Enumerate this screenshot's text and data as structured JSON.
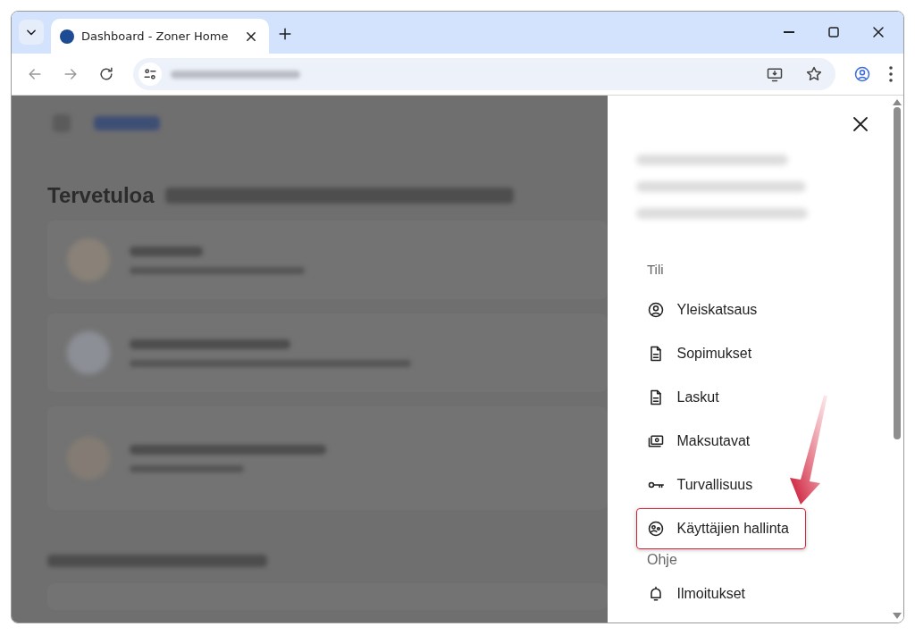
{
  "browser": {
    "tab": {
      "title": "Dashboard - Zoner Home",
      "selected": true
    }
  },
  "page": {
    "heading": "Tervetuloa"
  },
  "drawer": {
    "sections": [
      {
        "title": "Tili",
        "items": [
          {
            "label": "Yleiskatsaus",
            "kind": "person",
            "highlighted": false
          },
          {
            "label": "Sopimukset",
            "kind": "document",
            "highlighted": false
          },
          {
            "label": "Laskut",
            "kind": "document",
            "highlighted": false
          },
          {
            "label": "Maksutavat",
            "kind": "money",
            "highlighted": false
          },
          {
            "label": "Turvallisuus",
            "kind": "key",
            "highlighted": false
          },
          {
            "label": "Käyttäjien hallinta",
            "kind": "users",
            "highlighted": true
          }
        ]
      },
      {
        "title": "Ohje",
        "items": [
          {
            "label": "Ilmoitukset",
            "kind": "bell",
            "highlighted": false
          }
        ]
      }
    ]
  }
}
